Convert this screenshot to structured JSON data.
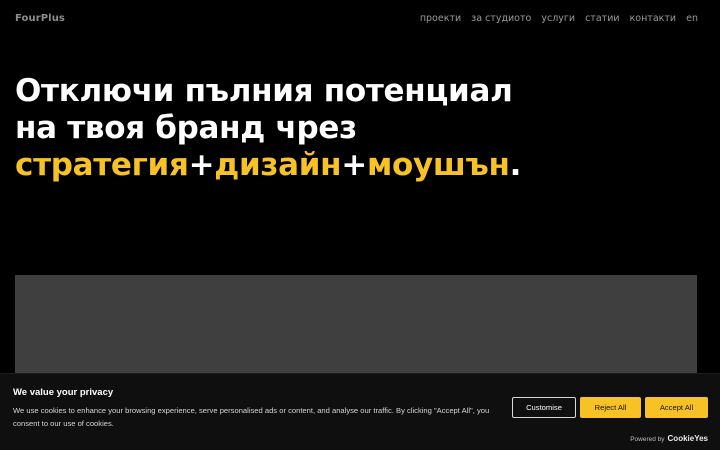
{
  "header": {
    "logo": "FourPlus",
    "nav": [
      "проекти",
      "за студиото",
      "услуги",
      "статии",
      "контакти",
      "en"
    ]
  },
  "hero": {
    "line1": "Отключи пълния потенциал",
    "line2": "на твоя бранд чрез",
    "line3": {
      "w1": "стратегия",
      "p1": "+",
      "w2": "дизайн",
      "p2": "+",
      "w3": "моушън",
      "end": "."
    }
  },
  "cookie": {
    "title": "We value your privacy",
    "text": "We use cookies to enhance your browsing experience, serve personalised ads or content, and analyse our traffic. By clicking \"Accept All\", you consent to our use of cookies.",
    "customise": "Customise",
    "reject": "Reject All",
    "accept": "Accept All",
    "powered_by": "Powered by",
    "powered_brand": "CookieYes"
  },
  "colors": {
    "accent": "#f6c225",
    "background": "#000000",
    "media_placeholder": "#3f3f3f"
  }
}
